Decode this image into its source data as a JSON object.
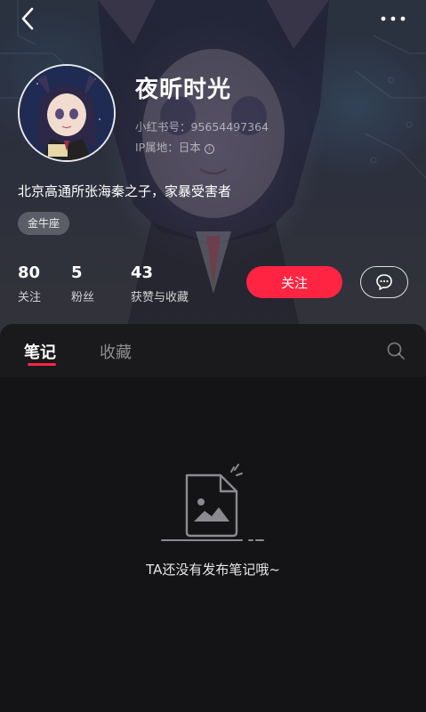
{
  "profile": {
    "nickname": "夜昕时光",
    "id_label": "小红书号：95654497364",
    "ip_label": "IP属地：日本",
    "bio": "北京高通所张海秦之子，家暴受害者",
    "tag": "金牛座"
  },
  "stats": [
    {
      "num": "80",
      "label": "关注"
    },
    {
      "num": "5",
      "label": "粉丝"
    },
    {
      "num": "43",
      "label": "获赞与收藏"
    }
  ],
  "actions": {
    "follow_label": "关注"
  },
  "tabs": [
    {
      "label": "笔记",
      "active": true
    },
    {
      "label": "收藏",
      "active": false
    }
  ],
  "empty_state": {
    "message": "TA还没有发布笔记哦~"
  },
  "colors": {
    "accent": "#ff2442",
    "background": "#141416"
  },
  "icons": {
    "back": "chevron-left-icon",
    "more": "more-dots-icon",
    "chat": "chat-bubble-icon",
    "search": "search-icon",
    "info": "info-icon"
  }
}
